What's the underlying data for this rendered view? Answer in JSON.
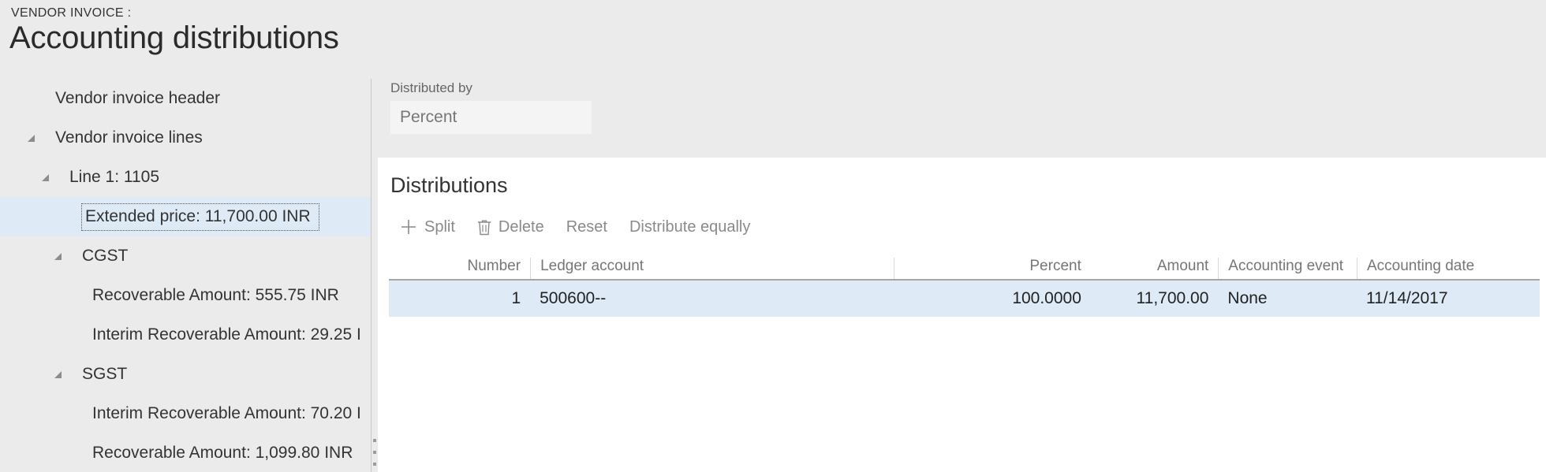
{
  "header": {
    "breadcrumb": "VENDOR INVOICE :",
    "title": "Accounting distributions"
  },
  "tree": {
    "items": [
      {
        "label": "Vendor invoice header",
        "level": 1,
        "expandable": false,
        "selected": false
      },
      {
        "label": "Vendor invoice lines",
        "level": 1,
        "expandable": true,
        "selected": false
      },
      {
        "label": "Line 1: 1105",
        "level": 2,
        "expandable": true,
        "selected": false
      },
      {
        "label": "Extended price: 11,700.00 INR",
        "level": 3,
        "expandable": false,
        "selected": true
      },
      {
        "label": "CGST",
        "level": 3,
        "expandable": true,
        "selected": false
      },
      {
        "label": "Recoverable Amount: 555.75 INR",
        "level": 4,
        "expandable": false,
        "selected": false
      },
      {
        "label": "Interim Recoverable Amount: 29.25 I",
        "level": 4,
        "expandable": false,
        "selected": false
      },
      {
        "label": "SGST",
        "level": 3,
        "expandable": true,
        "selected": false
      },
      {
        "label": "Interim Recoverable Amount: 70.20 I",
        "level": 4,
        "expandable": false,
        "selected": false
      },
      {
        "label": "Recoverable Amount: 1,099.80 INR",
        "level": 4,
        "expandable": false,
        "selected": false
      }
    ]
  },
  "distributed_by": {
    "label": "Distributed by",
    "value": "Percent"
  },
  "distributions": {
    "section_title": "Distributions",
    "toolbar": {
      "split_label": "Split",
      "delete_label": "Delete",
      "reset_label": "Reset",
      "distribute_equally_label": "Distribute equally"
    },
    "columns": {
      "number": "Number",
      "ledger_account": "Ledger account",
      "percent": "Percent",
      "amount": "Amount",
      "accounting_event": "Accounting event",
      "accounting_date": "Accounting date"
    },
    "rows": [
      {
        "number": "1",
        "ledger_account": "500600--",
        "percent": "100.0000",
        "amount": "11,700.00",
        "accounting_event": "None",
        "accounting_date": "11/14/2017"
      }
    ]
  },
  "colors": {
    "page_background": "#ebebeb",
    "panel_background": "#ffffff",
    "selection": "#deeaf6",
    "toolbar_text": "#8a8a8a"
  }
}
